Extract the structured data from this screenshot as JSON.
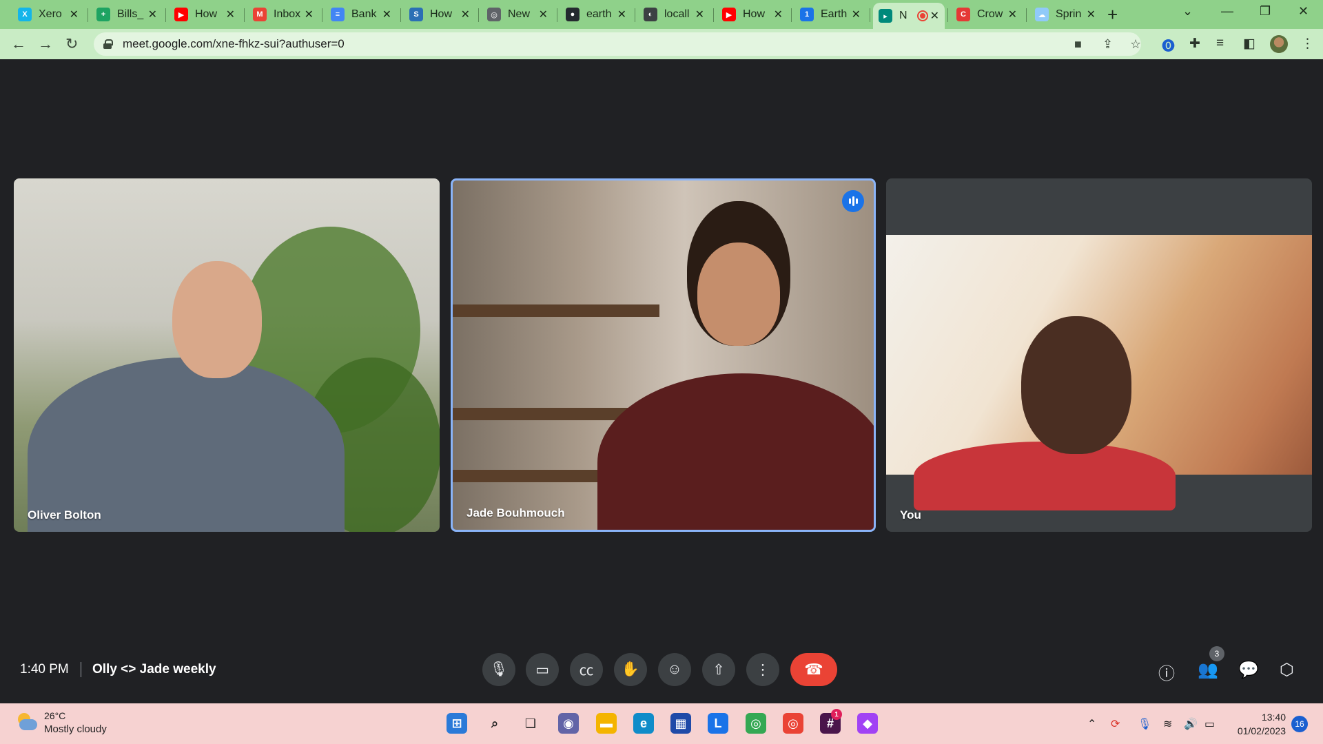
{
  "browser": {
    "tabs": [
      {
        "title": "Xero",
        "favicon_color": "#13b5ea",
        "favicon_glyph": "X"
      },
      {
        "title": "Bills_",
        "favicon_color": "#1ea362",
        "favicon_glyph": "+"
      },
      {
        "title": "How",
        "favicon_color": "#ff0000",
        "favicon_glyph": "▶"
      },
      {
        "title": "Inbox",
        "favicon_color": "#ea4335",
        "favicon_glyph": "M"
      },
      {
        "title": "Bank",
        "favicon_color": "#4285f4",
        "favicon_glyph": "≡"
      },
      {
        "title": "How",
        "favicon_color": "#2b6fb5",
        "favicon_glyph": "S"
      },
      {
        "title": "New",
        "favicon_color": "#5f6368",
        "favicon_glyph": "◎"
      },
      {
        "title": "earth",
        "favicon_color": "#24292f",
        "favicon_glyph": "●"
      },
      {
        "title": "locall",
        "favicon_color": "#3c4043",
        "favicon_glyph": "◐"
      },
      {
        "title": "How",
        "favicon_color": "#ff0000",
        "favicon_glyph": "▶"
      },
      {
        "title": "Earth",
        "favicon_color": "#1a73e8",
        "favicon_glyph": "1"
      },
      {
        "title": "N",
        "favicon_color": "#00897b",
        "favicon_glyph": "▸",
        "active": true,
        "recording": true
      },
      {
        "title": "Crow",
        "favicon_color": "#e53935",
        "favicon_glyph": "C"
      },
      {
        "title": "Sprin",
        "favicon_color": "#90caf9",
        "favicon_glyph": "☁"
      }
    ],
    "new_tab_label": "+",
    "url": "meet.google.com/xne-fhkz-sui?authuser=0"
  },
  "meet": {
    "participants": [
      {
        "name": "Oliver Bolton"
      },
      {
        "name": "Jade Bouhmouch",
        "speaking": true
      },
      {
        "name": "You"
      }
    ],
    "time": "1:40 PM",
    "meeting_title": "Olly <> Jade weekly",
    "people_count": "3"
  },
  "taskbar": {
    "temperature": "26°C",
    "condition": "Mostly cloudy",
    "time": "13:40",
    "date": "01/02/2023",
    "notification_count": "16",
    "slack_badge": "1"
  }
}
